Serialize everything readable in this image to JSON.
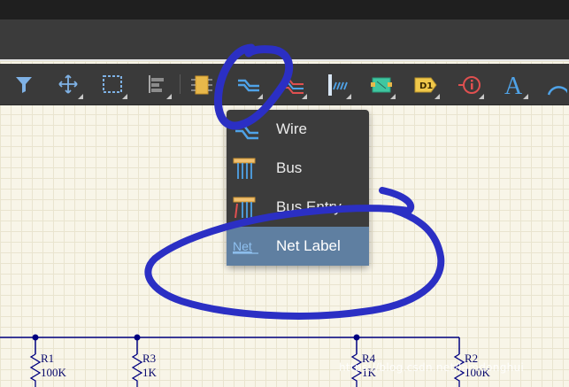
{
  "colors": {
    "toolbar_bg": "#3a3a3a",
    "menu_bg": "#3c3c3c",
    "menu_active": "#5f7fa1",
    "wire": "#000080",
    "annotation_ink": "#2b2fc4",
    "canvas_bg": "#f8f5e8"
  },
  "toolbar": {
    "buttons": [
      {
        "icon": "filter-icon"
      },
      {
        "icon": "move-icon"
      },
      {
        "icon": "select-area-icon"
      },
      {
        "icon": "align-icon"
      },
      {
        "icon": "component-icon"
      },
      {
        "icon": "wire-icon",
        "highlighted": true
      },
      {
        "icon": "power-port-icon"
      },
      {
        "icon": "harness-icon"
      },
      {
        "icon": "sheet-symbol-icon"
      },
      {
        "icon": "device-sheet-icon",
        "text": "D1"
      },
      {
        "icon": "parameter-icon"
      },
      {
        "icon": "text-icon",
        "text": "A"
      },
      {
        "icon": "arc-icon"
      }
    ]
  },
  "menu": {
    "items": [
      {
        "label": "Wire",
        "icon": "wire-icon"
      },
      {
        "label": "Bus",
        "icon": "bus-icon"
      },
      {
        "label": "Bus Entry",
        "icon": "bus-entry-icon"
      },
      {
        "label": "Net Label",
        "icon": "net-label-icon",
        "icon_text": "Net",
        "active": true
      }
    ]
  },
  "schematic": {
    "components": [
      {
        "ref": "R1",
        "value": "100K"
      },
      {
        "ref": "R3",
        "value": "1K"
      },
      {
        "ref": "R4",
        "value": "1K"
      },
      {
        "ref": "R2",
        "value": "100K"
      }
    ]
  },
  "watermark": "https://blog.csdn.net/lamdonghui"
}
